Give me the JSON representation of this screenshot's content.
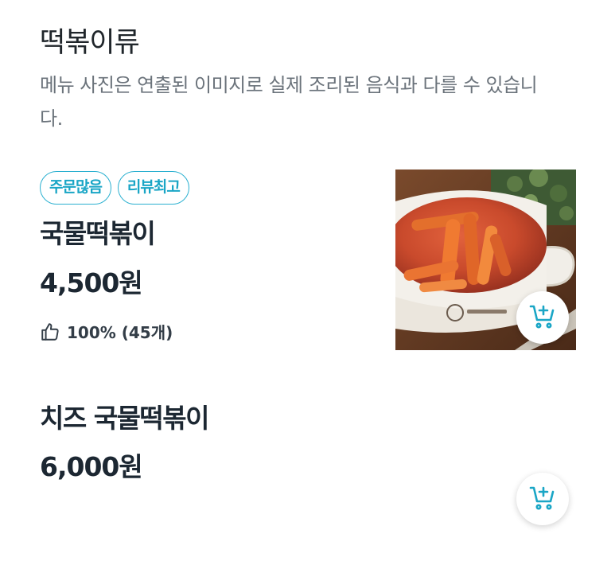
{
  "category": {
    "title": "떡볶이류",
    "description": "메뉴 사진은 연출된 이미지로 실제 조리된 음식과 다를 수 있습니다."
  },
  "menu_items": [
    {
      "badges": [
        "주문많음",
        "리뷰최고"
      ],
      "name": "국물떡볶이",
      "price": "4,500원",
      "rating": "100% (45개)",
      "rating_icon": "thumbs-up-icon",
      "has_image": true,
      "cart_icon": "add-to-cart-icon"
    },
    {
      "name": "치즈 국물떡볶이",
      "price": "6,000원",
      "cart_icon": "add-to-cart-icon"
    }
  ],
  "colors": {
    "accent": "#2ab0d0",
    "text_primary": "#1c2732",
    "text_secondary": "#6b737b"
  }
}
